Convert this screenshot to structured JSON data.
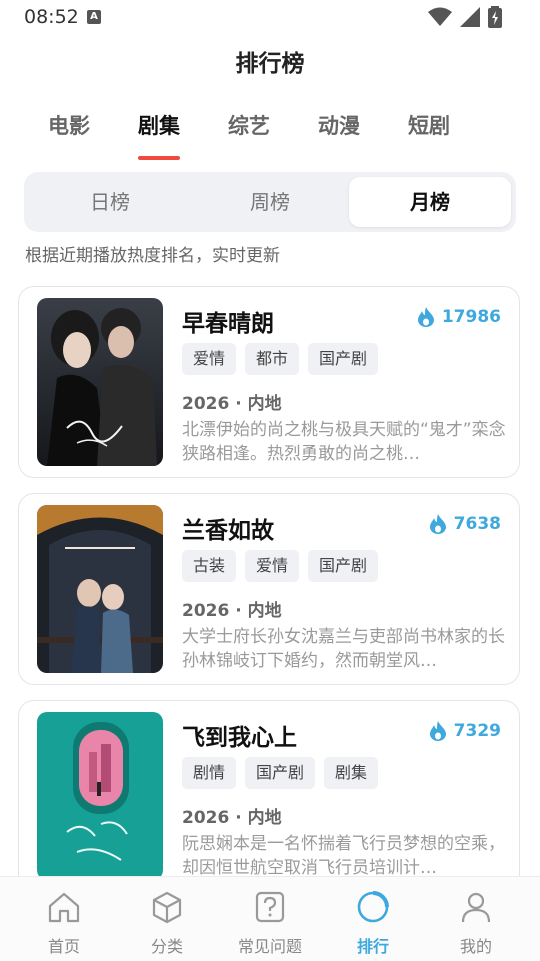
{
  "status_bar": {
    "time": "08:52"
  },
  "header": {
    "title": "排行榜"
  },
  "category_tabs": [
    {
      "label": "电影",
      "active": false
    },
    {
      "label": "剧集",
      "active": true
    },
    {
      "label": "综艺",
      "active": false
    },
    {
      "label": "动漫",
      "active": false
    },
    {
      "label": "短剧",
      "active": false
    }
  ],
  "period_tabs": [
    {
      "label": "日榜",
      "active": false
    },
    {
      "label": "周榜",
      "active": false
    },
    {
      "label": "月榜",
      "active": true
    }
  ],
  "subtitle": "根据近期播放热度排名，实时更新",
  "items": [
    {
      "title": "早春晴朗",
      "heat": "17986",
      "tags": [
        "爱情",
        "都市",
        "国产剧"
      ],
      "meta": "2026 · 内地",
      "description": "北漂伊始的尚之桃与极具天赋的“鬼才”栾念狭路相逢。热烈勇敢的尚之桃…"
    },
    {
      "title": "兰香如故",
      "heat": "7638",
      "tags": [
        "古装",
        "爱情",
        "国产剧"
      ],
      "meta": "2026 · 内地",
      "description": "大学士府长孙女沈嘉兰与吏部尚书林家的长孙林锦岐订下婚约，然而朝堂风…"
    },
    {
      "title": "飞到我心上",
      "heat": "7329",
      "tags": [
        "剧情",
        "国产剧",
        "剧集"
      ],
      "meta": "2026 · 内地",
      "description": "阮思娴本是一名怀揣着飞行员梦想的空乘，却因恒世航空取消飞行员培训计…"
    }
  ],
  "bottom_nav": [
    {
      "label": "首页",
      "icon": "home-icon",
      "active": false
    },
    {
      "label": "分类",
      "icon": "cube-icon",
      "active": false
    },
    {
      "label": "常见问题",
      "icon": "question-icon",
      "active": false
    },
    {
      "label": "排行",
      "icon": "ranking-icon",
      "active": true
    },
    {
      "label": "我的",
      "icon": "user-icon",
      "active": false
    }
  ],
  "colors": {
    "accent": "#3fa8dc",
    "tab_indicator": "#f04a3f"
  }
}
